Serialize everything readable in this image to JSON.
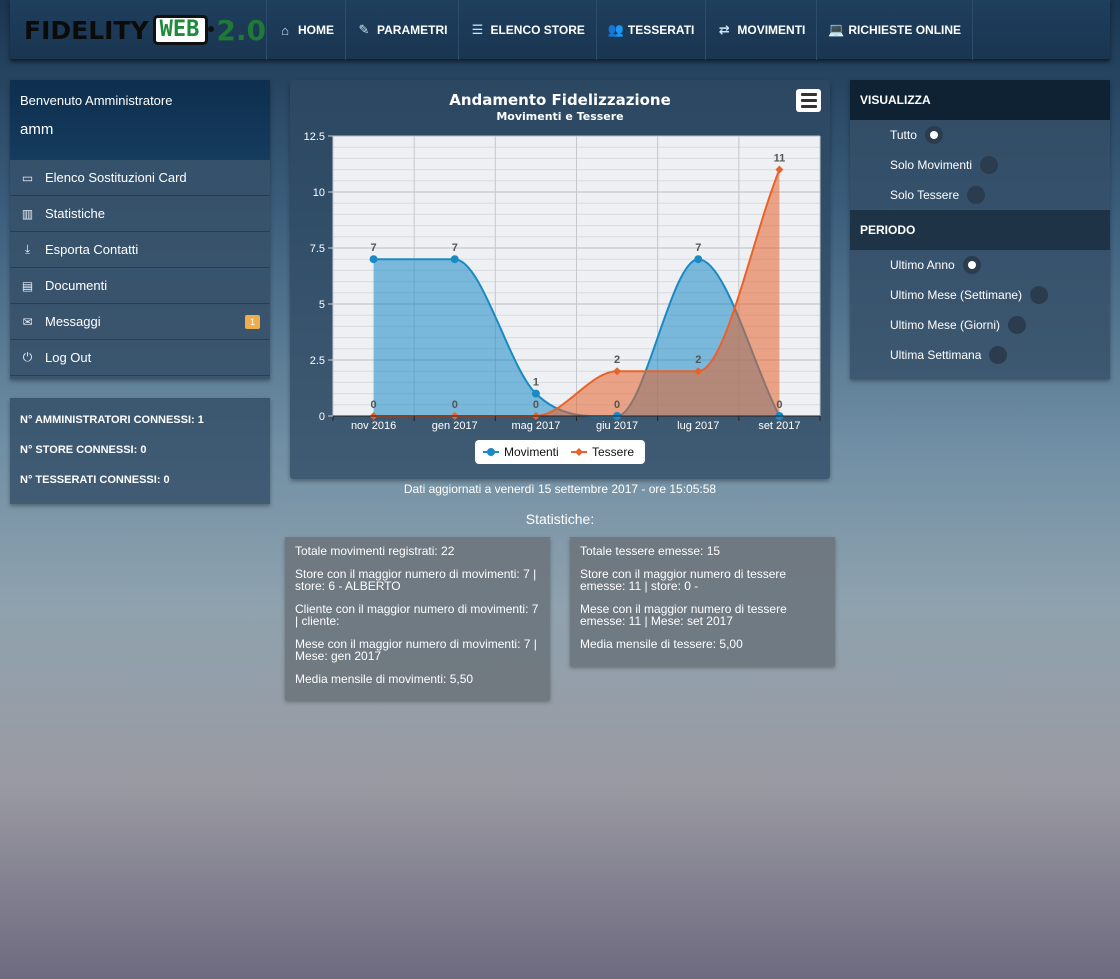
{
  "brand": {
    "fidelity": "FIDELITY",
    "web": "WEB",
    "version": "2.0"
  },
  "nav": [
    {
      "label": "HOME",
      "icon": "home-icon",
      "glyph": "⌂"
    },
    {
      "label": "PARAMETRI",
      "icon": "pencil-icon",
      "glyph": "✎"
    },
    {
      "label": "ELENCO STORE",
      "icon": "list-icon",
      "glyph": "☰"
    },
    {
      "label": "TESSERATI",
      "icon": "users-icon",
      "glyph": "👥"
    },
    {
      "label": "MOVIMENTI",
      "icon": "exchange-icon",
      "glyph": "⇄"
    },
    {
      "label": "RICHIESTE ONLINE",
      "icon": "laptop-icon",
      "glyph": "💻"
    }
  ],
  "user": {
    "welcome": "Benvenuto Amministratore",
    "name": "amm"
  },
  "sidebar": [
    {
      "label": "Elenco Sostituzioni Card",
      "icon": "credit-card-icon",
      "glyph": "▭"
    },
    {
      "label": "Statistiche",
      "icon": "bar-chart-icon",
      "glyph": "▥"
    },
    {
      "label": "Esporta Contatti",
      "icon": "download-icon",
      "glyph": "⤓"
    },
    {
      "label": "Documenti",
      "icon": "document-icon",
      "glyph": "▤"
    },
    {
      "label": "Messaggi",
      "icon": "envelope-icon",
      "glyph": "✉",
      "badge": "1"
    },
    {
      "label": "Log Out",
      "icon": "power-icon",
      "glyph": "⏻"
    }
  ],
  "connections": [
    "N° AMMINISTRATORI CONNESSI: 1",
    "N° STORE CONNESSI: 0",
    "N° TESSERATI CONNESSI: 0"
  ],
  "chart_data": {
    "type": "area",
    "title": "Andamento Fidelizzazione",
    "subtitle": "Movimenti e Tessere",
    "categories": [
      "nov 2016",
      "gen 2017",
      "mag 2017",
      "giu 2017",
      "lug 2017",
      "set 2017"
    ],
    "ylim": [
      0,
      12.5
    ],
    "yticks": [
      "0",
      "2.5",
      "5",
      "7.5",
      "10",
      "12.5"
    ],
    "legend_position": "bottom",
    "series": [
      {
        "name": "Movimenti",
        "values": [
          7,
          7,
          1,
          0,
          7,
          0
        ],
        "color": "#1a8ac4"
      },
      {
        "name": "Tessere",
        "values": [
          0,
          0,
          0,
          2,
          2,
          11
        ],
        "color": "#e8632b"
      }
    ]
  },
  "updated": "Dati aggiornati a venerdì 15 settembre 2017 - ore 15:05:58",
  "stats_title": "Statistiche:",
  "stats_left": [
    "Totale movimenti registrati: 22",
    "Store con il maggior numero di movimenti: 7 | store: 6 - ALBERTO",
    "Cliente con il maggior numero di movimenti: 7 | cliente:",
    "Mese con il maggior numero di movimenti: 7 | Mese: gen 2017",
    "Media mensile di movimenti: 5,50"
  ],
  "stats_right": [
    "Totale tessere emesse: 15",
    "Store con il maggior numero di tessere emesse: 11 | store: 0 -",
    "Mese con il maggior numero di tessere emesse: 11 | Mese: set 2017",
    "Media mensile di tessere: 5,00"
  ],
  "visualizza": {
    "title": "VISUALIZZA",
    "options": [
      {
        "label": "Tutto",
        "selected": true
      },
      {
        "label": "Solo Movimenti",
        "selected": false
      },
      {
        "label": "Solo Tessere",
        "selected": false
      }
    ]
  },
  "periodo": {
    "title": "PERIODO",
    "options": [
      {
        "label": "Ultimo Anno",
        "selected": true
      },
      {
        "label": "Ultimo Mese (Settimane)",
        "selected": false
      },
      {
        "label": "Ultimo Mese (Giorni)",
        "selected": false
      },
      {
        "label": "Ultima Settimana",
        "selected": false
      }
    ]
  }
}
